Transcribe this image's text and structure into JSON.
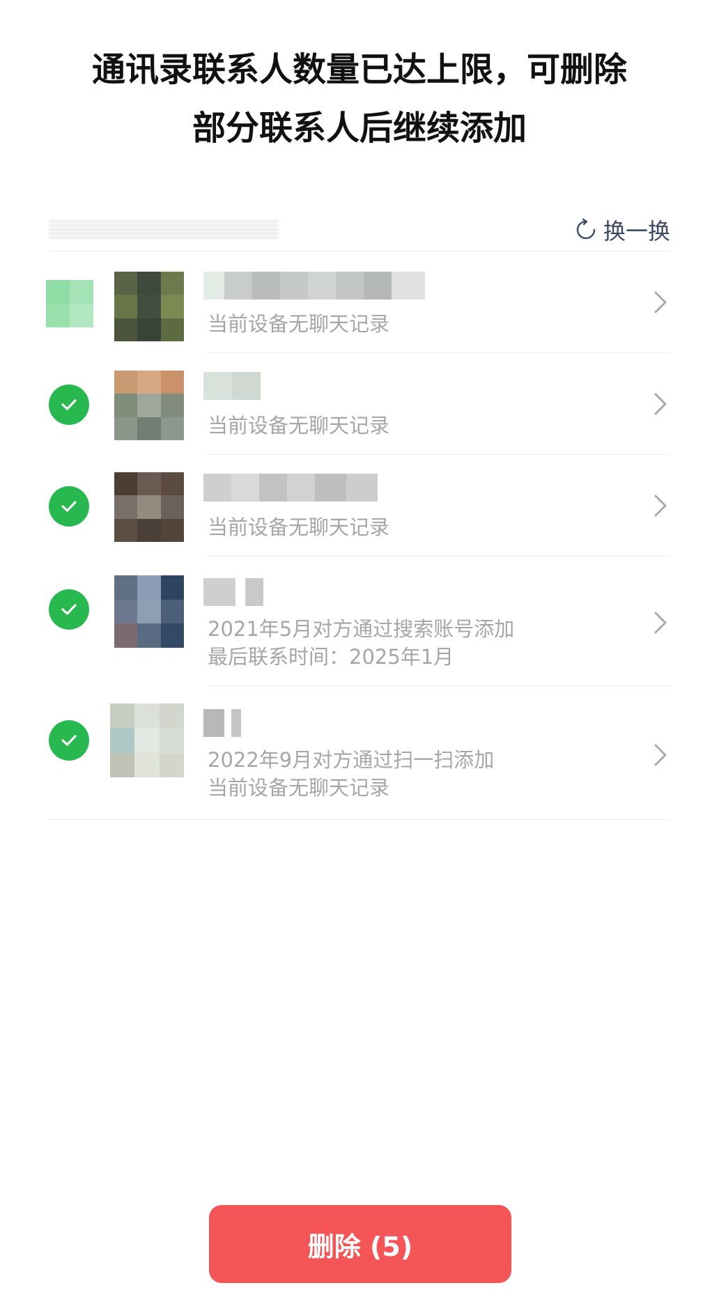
{
  "title": {
    "line1": "通讯录联系人数量已达上限，可删除",
    "line2": "部分联系人后继续添加"
  },
  "header": {
    "refresh_label": "换一换"
  },
  "contacts": [
    {
      "line1": "当前设备无聊天记录",
      "line2": "",
      "selected": false
    },
    {
      "line1": "当前设备无聊天记录",
      "line2": "",
      "selected": true
    },
    {
      "line1": "当前设备无聊天记录",
      "line2": "",
      "selected": true
    },
    {
      "line1": "2021年5月对方通过搜索账号添加",
      "line2": "最后联系时间：2025年1月",
      "selected": true
    },
    {
      "line1": "2022年9月对方通过扫一扫添加",
      "line2": "当前设备无聊天记录",
      "selected": true
    }
  ],
  "delete_button": {
    "label": "删除 (5)"
  },
  "colors": {
    "accent_green": "#28b850",
    "danger_red": "#f45556",
    "link_blue": "#3c4a63"
  }
}
